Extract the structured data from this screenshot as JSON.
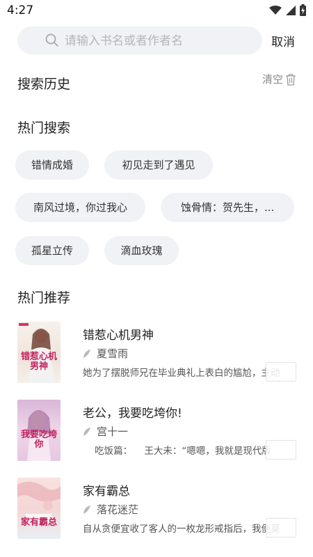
{
  "status": {
    "time": "4:27"
  },
  "search": {
    "placeholder": "请输入书名或者作者名",
    "cancel_label": "取消"
  },
  "history": {
    "title": "搜索历史",
    "clear_label": "清空"
  },
  "hot_search": {
    "title": "热门搜索",
    "tags": [
      "错情成婚",
      "初见走到了遇见",
      "南风过境，你过我心",
      "蚀骨情：贺先生，...",
      "孤星立传",
      "滴血玫瑰"
    ]
  },
  "recommend": {
    "title": "热门推荐",
    "books": [
      {
        "title": "错惹心机男神",
        "author": "夏雪雨",
        "desc": "她为了摆脱师兄在毕业典礼上表白的尴尬，主动",
        "cover_text": "错惹心机男神",
        "cover_bg": "#f3eee9"
      },
      {
        "title": "老公，我要吃垮你!",
        "author": "宫十一",
        "desc": "    吃饭篇：    王大未：“嗯嗯，我就是现代版",
        "cover_text": "我要吃垮你",
        "cover_bg": "#e7cfe4"
      },
      {
        "title": "家有霸总",
        "author": "落花迷茫",
        "desc": "自从贪便宜收了客人的一枚龙形戒指后，我便莫",
        "cover_text": "家有霸总",
        "cover_bg": "#f2dada"
      }
    ]
  }
}
